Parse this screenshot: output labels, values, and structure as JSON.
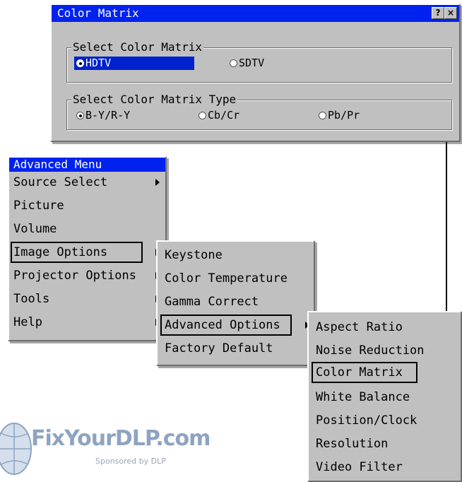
{
  "dialog": {
    "title": "Color Matrix",
    "help_button": "?",
    "close_button": "×",
    "group1": {
      "label": "Select Color Matrix",
      "options": [
        "HDTV",
        "SDTV"
      ],
      "selected": "HDTV"
    },
    "group2": {
      "label": "Select Color Matrix Type",
      "options": [
        "B-Y/R-Y",
        "Cb/Cr",
        "Pb/Pr"
      ],
      "selected": "B-Y/R-Y"
    }
  },
  "advanced_menu": {
    "title": "Advanced Menu",
    "items": [
      "Source Select",
      "Picture",
      "Volume",
      "Image Options",
      "Projector Options",
      "Tools",
      "Help"
    ]
  },
  "image_options_menu": {
    "items": [
      "Keystone",
      "Color Temperature",
      "Gamma Correct",
      "Advanced Options",
      "Factory Default"
    ]
  },
  "advanced_options_menu": {
    "items": [
      "Aspect Ratio",
      "Noise Reduction",
      "Color Matrix",
      "White Balance",
      "Position/Clock",
      "Resolution",
      "Video Filter"
    ]
  },
  "watermark": {
    "text": "FixYourDLP.com",
    "sub": "Sponsored by DLP"
  },
  "colors": {
    "panel": "#c0c0c0",
    "titlebar": "#0022ee",
    "selection": "#0022cc"
  }
}
